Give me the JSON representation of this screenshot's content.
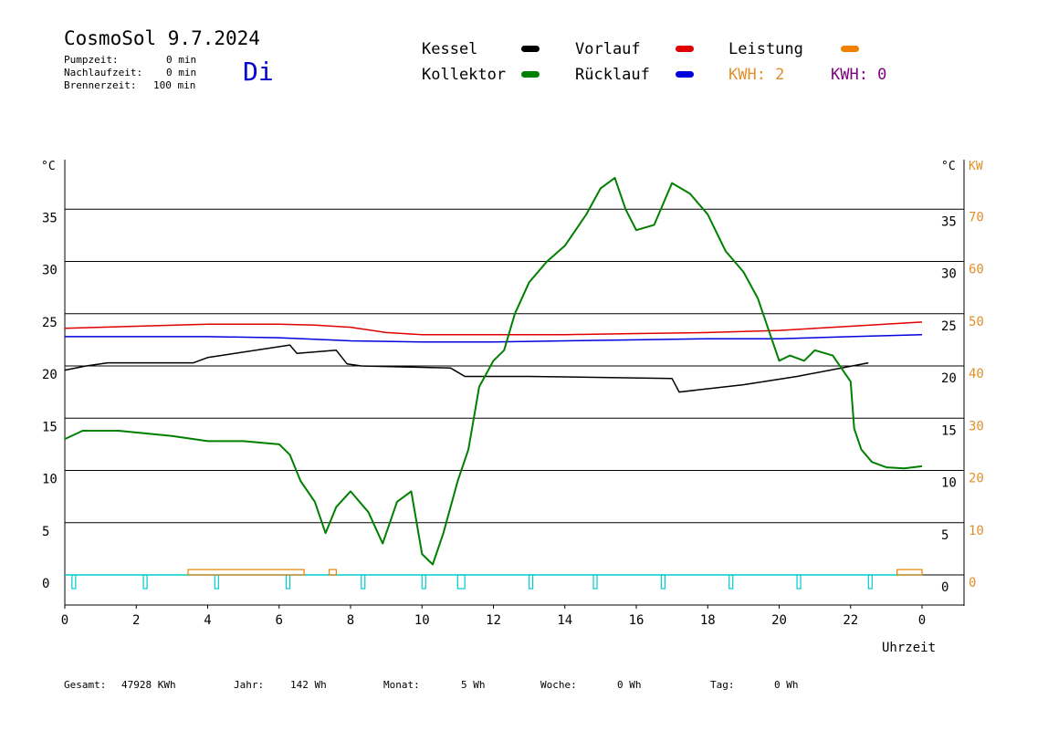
{
  "header": {
    "title": "CosmoSol 9.7.2024",
    "day": "Di",
    "stats": [
      {
        "label": "Pumpzeit:",
        "value": "0 min"
      },
      {
        "label": "Nachlaufzeit:",
        "value": "0 min"
      },
      {
        "label": "Brennerzeit:",
        "value": "100 min"
      }
    ]
  },
  "legend": {
    "kessel": {
      "label": "Kessel",
      "color": "#000000"
    },
    "vorlauf": {
      "label": "Vorlauf",
      "color": "#e00000"
    },
    "leistung": {
      "label": "Leistung",
      "color": "#f08000"
    },
    "kollektor": {
      "label": "Kollektor",
      "color": "#008000"
    },
    "ruecklauf": {
      "label": "Rücklauf",
      "color": "#0000dd"
    },
    "kwh1": "KWH: 2",
    "kwh2": "KWH: 0",
    "kwh1_color": "#e0902a",
    "kwh2_color": "#800080"
  },
  "footer": {
    "gesamt_label": "Gesamt:",
    "gesamt_value": "47928 KWh",
    "jahr_label": "Jahr:",
    "jahr_value": "142 Wh",
    "monat_label": "Monat:",
    "monat_value": "5 Wh",
    "woche_label": "Woche:",
    "woche_value": "0 Wh",
    "tag_label": "Tag:",
    "tag_value": "0 Wh"
  },
  "chart_data": {
    "type": "line",
    "xlabel": "Uhrzeit",
    "ylabel_left": "°C",
    "ylabel_right": "°C",
    "ylabel_right2": "KW",
    "xlim": [
      0,
      24
    ],
    "ylim": [
      0,
      40
    ],
    "x_ticks": [
      0,
      2,
      4,
      6,
      8,
      10,
      12,
      14,
      16,
      18,
      20,
      22,
      24
    ],
    "x_tick_labels": [
      "0",
      "2",
      "4",
      "6",
      "8",
      "10",
      "12",
      "14",
      "16",
      "18",
      "20",
      "22",
      "0"
    ],
    "y_ticks": [
      0,
      5,
      10,
      15,
      20,
      25,
      30,
      35
    ],
    "y_tick_labels": [
      "0",
      "5",
      "10",
      "15",
      "20",
      "25",
      "30",
      "35"
    ],
    "y2_tick_labels": [
      "0",
      "10",
      "20",
      "30",
      "40",
      "50",
      "60",
      "70"
    ],
    "series": [
      {
        "name": "Kessel",
        "color": "#000000",
        "x": [
          0,
          0.6,
          1,
          1.2,
          3.6,
          4,
          6.3,
          6.5,
          7.6,
          7.9,
          8.3,
          10.8,
          11.2,
          13,
          17,
          17.2,
          19,
          20.5,
          22.5
        ],
        "y": [
          19.6,
          20,
          20.2,
          20.3,
          20.3,
          20.8,
          22,
          21.2,
          21.5,
          20.2,
          20,
          19.8,
          19,
          19,
          18.8,
          17.5,
          18.2,
          19,
          20.3
        ]
      },
      {
        "name": "Vorlauf",
        "color": "#e00000",
        "x": [
          0,
          2,
          4,
          6,
          7,
          8,
          9,
          10,
          11,
          12,
          14,
          16,
          18,
          20,
          22,
          24
        ],
        "y": [
          23.6,
          23.8,
          24,
          24,
          23.9,
          23.7,
          23.2,
          23,
          23,
          23,
          23,
          23.1,
          23.2,
          23.4,
          23.8,
          24.2
        ]
      },
      {
        "name": "Rücklauf",
        "color": "#0000dd",
        "x": [
          0,
          2,
          4,
          6,
          8,
          10,
          12,
          14,
          16,
          18,
          20,
          22,
          24
        ],
        "y": [
          22.8,
          22.8,
          22.8,
          22.7,
          22.4,
          22.3,
          22.3,
          22.4,
          22.5,
          22.6,
          22.6,
          22.8,
          23
        ]
      },
      {
        "name": "Kollektor",
        "color": "#008000",
        "x": [
          0,
          0.5,
          1.5,
          3,
          4,
          5,
          6,
          6.3,
          6.6,
          7,
          7.3,
          7.6,
          8,
          8.5,
          8.9,
          9.3,
          9.7,
          10,
          10.3,
          10.6,
          11,
          11.3,
          11.6,
          12,
          12.3,
          12.6,
          13,
          13.5,
          14,
          14.3,
          14.6,
          15,
          15.4,
          15.7,
          16,
          16.5,
          17,
          17.5,
          18,
          18.5,
          19,
          19.4,
          19.8,
          20,
          20.3,
          20.7,
          21,
          21.5,
          22,
          22.1,
          22.3,
          22.6,
          23,
          23.5,
          24
        ],
        "y": [
          13,
          13.8,
          13.8,
          13.3,
          12.8,
          12.8,
          12.5,
          11.5,
          9,
          7,
          4,
          6.5,
          8,
          6,
          3,
          7,
          8,
          2,
          1,
          4,
          9,
          12,
          18,
          20.5,
          21.5,
          25,
          28,
          30,
          31.5,
          33,
          34.5,
          37,
          38,
          35,
          33,
          33.5,
          37.5,
          36.5,
          34.5,
          31,
          29,
          26.5,
          22.5,
          20.5,
          21,
          20.5,
          21.5,
          21,
          18.5,
          14,
          12,
          10.8,
          10.3,
          10.2,
          10.4
        ]
      }
    ],
    "leistung": {
      "name": "Leistung",
      "color": "#f08000",
      "unit": "kW",
      "segments": [
        [
          3.45,
          6.7
        ],
        [
          7.4,
          7.6
        ],
        [
          23.3,
          24
        ]
      ],
      "values": [
        0.5,
        0.5,
        0.5
      ]
    },
    "pump": {
      "name": "Pumpe",
      "color": "#00cccc",
      "pulses": [
        0.2,
        2.2,
        4.2,
        6.2,
        8.3,
        10,
        11,
        13,
        14.8,
        16.7,
        18.6,
        20.5,
        22.5
      ],
      "widths": [
        0.1,
        0.1,
        0.1,
        0.1,
        0.1,
        0.1,
        0.2,
        0.1,
        0.1,
        0.1,
        0.1,
        0.1,
        0.1
      ]
    }
  }
}
